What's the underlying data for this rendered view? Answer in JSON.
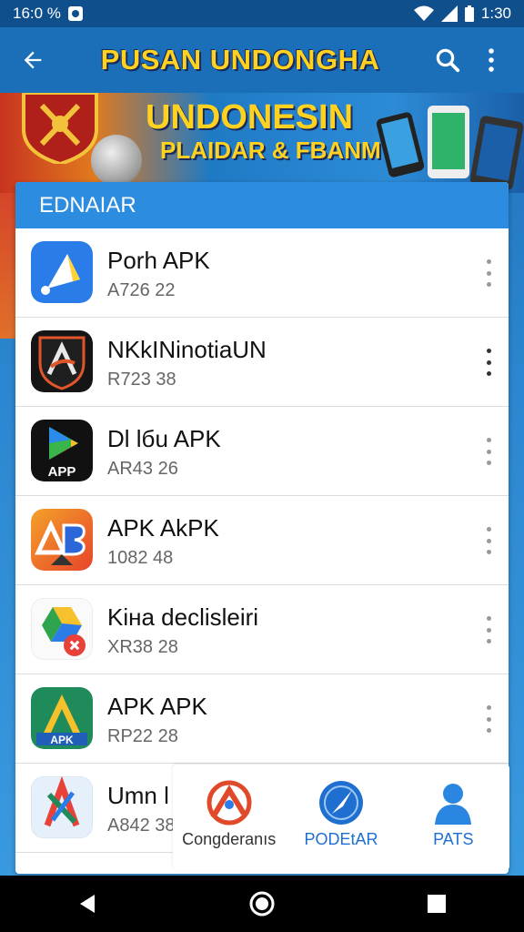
{
  "status_bar": {
    "left_text": "16:0 %",
    "time": "1:30",
    "icons": [
      "notification-icon",
      "wifi-icon",
      "signal-icon",
      "battery-icon"
    ]
  },
  "app_bar": {
    "title": "PUSAN UNDONGHA",
    "icons": [
      "back-arrow-icon",
      "search-icon",
      "more-vert-icon"
    ]
  },
  "banner": {
    "line1": "UNDONESIN",
    "line2": "PLAIDAR & FBANM"
  },
  "card": {
    "header": "EDNAIAR"
  },
  "apps": [
    {
      "name": "Porh APK",
      "subtitle": "A726 22",
      "icon": "arrow-app-icon"
    },
    {
      "name": "NKkINinotiaUN",
      "subtitle": "R723 38",
      "icon": "shield-app-icon"
    },
    {
      "name": "Dl lбu APK",
      "subtitle": "AR43 26",
      "icon": "play-app-icon"
    },
    {
      "name": "APK AkPK",
      "subtitle": "1082 48",
      "icon": "ab-app-icon"
    },
    {
      "name": "Kiнa declisleiri",
      "subtitle": "XR38 28",
      "icon": "drive-app-icon"
    },
    {
      "name": "APK APK",
      "subtitle": "RP22 28",
      "icon": "apk-triangle-app-icon"
    },
    {
      "name": "Umn l",
      "subtitle": "A842 38",
      "icon": "x-app-icon"
    }
  ],
  "bottom_nav": [
    {
      "label": "Congderanıs",
      "icon": "ring-arrow-icon",
      "color": "#e04a2a"
    },
    {
      "label": "PODEtAR",
      "icon": "compass-icon",
      "color": "#1f6fd0"
    },
    {
      "label": "PATS",
      "icon": "person-icon",
      "color": "#1f6fd0"
    }
  ],
  "system_nav": {
    "icons": [
      "nav-back-icon",
      "nav-home-icon",
      "nav-recents-icon"
    ]
  },
  "colors": {
    "app_bar": "#1a6fb8",
    "card_header": "#2b8ce0",
    "title_yellow": "#ffd21f"
  }
}
